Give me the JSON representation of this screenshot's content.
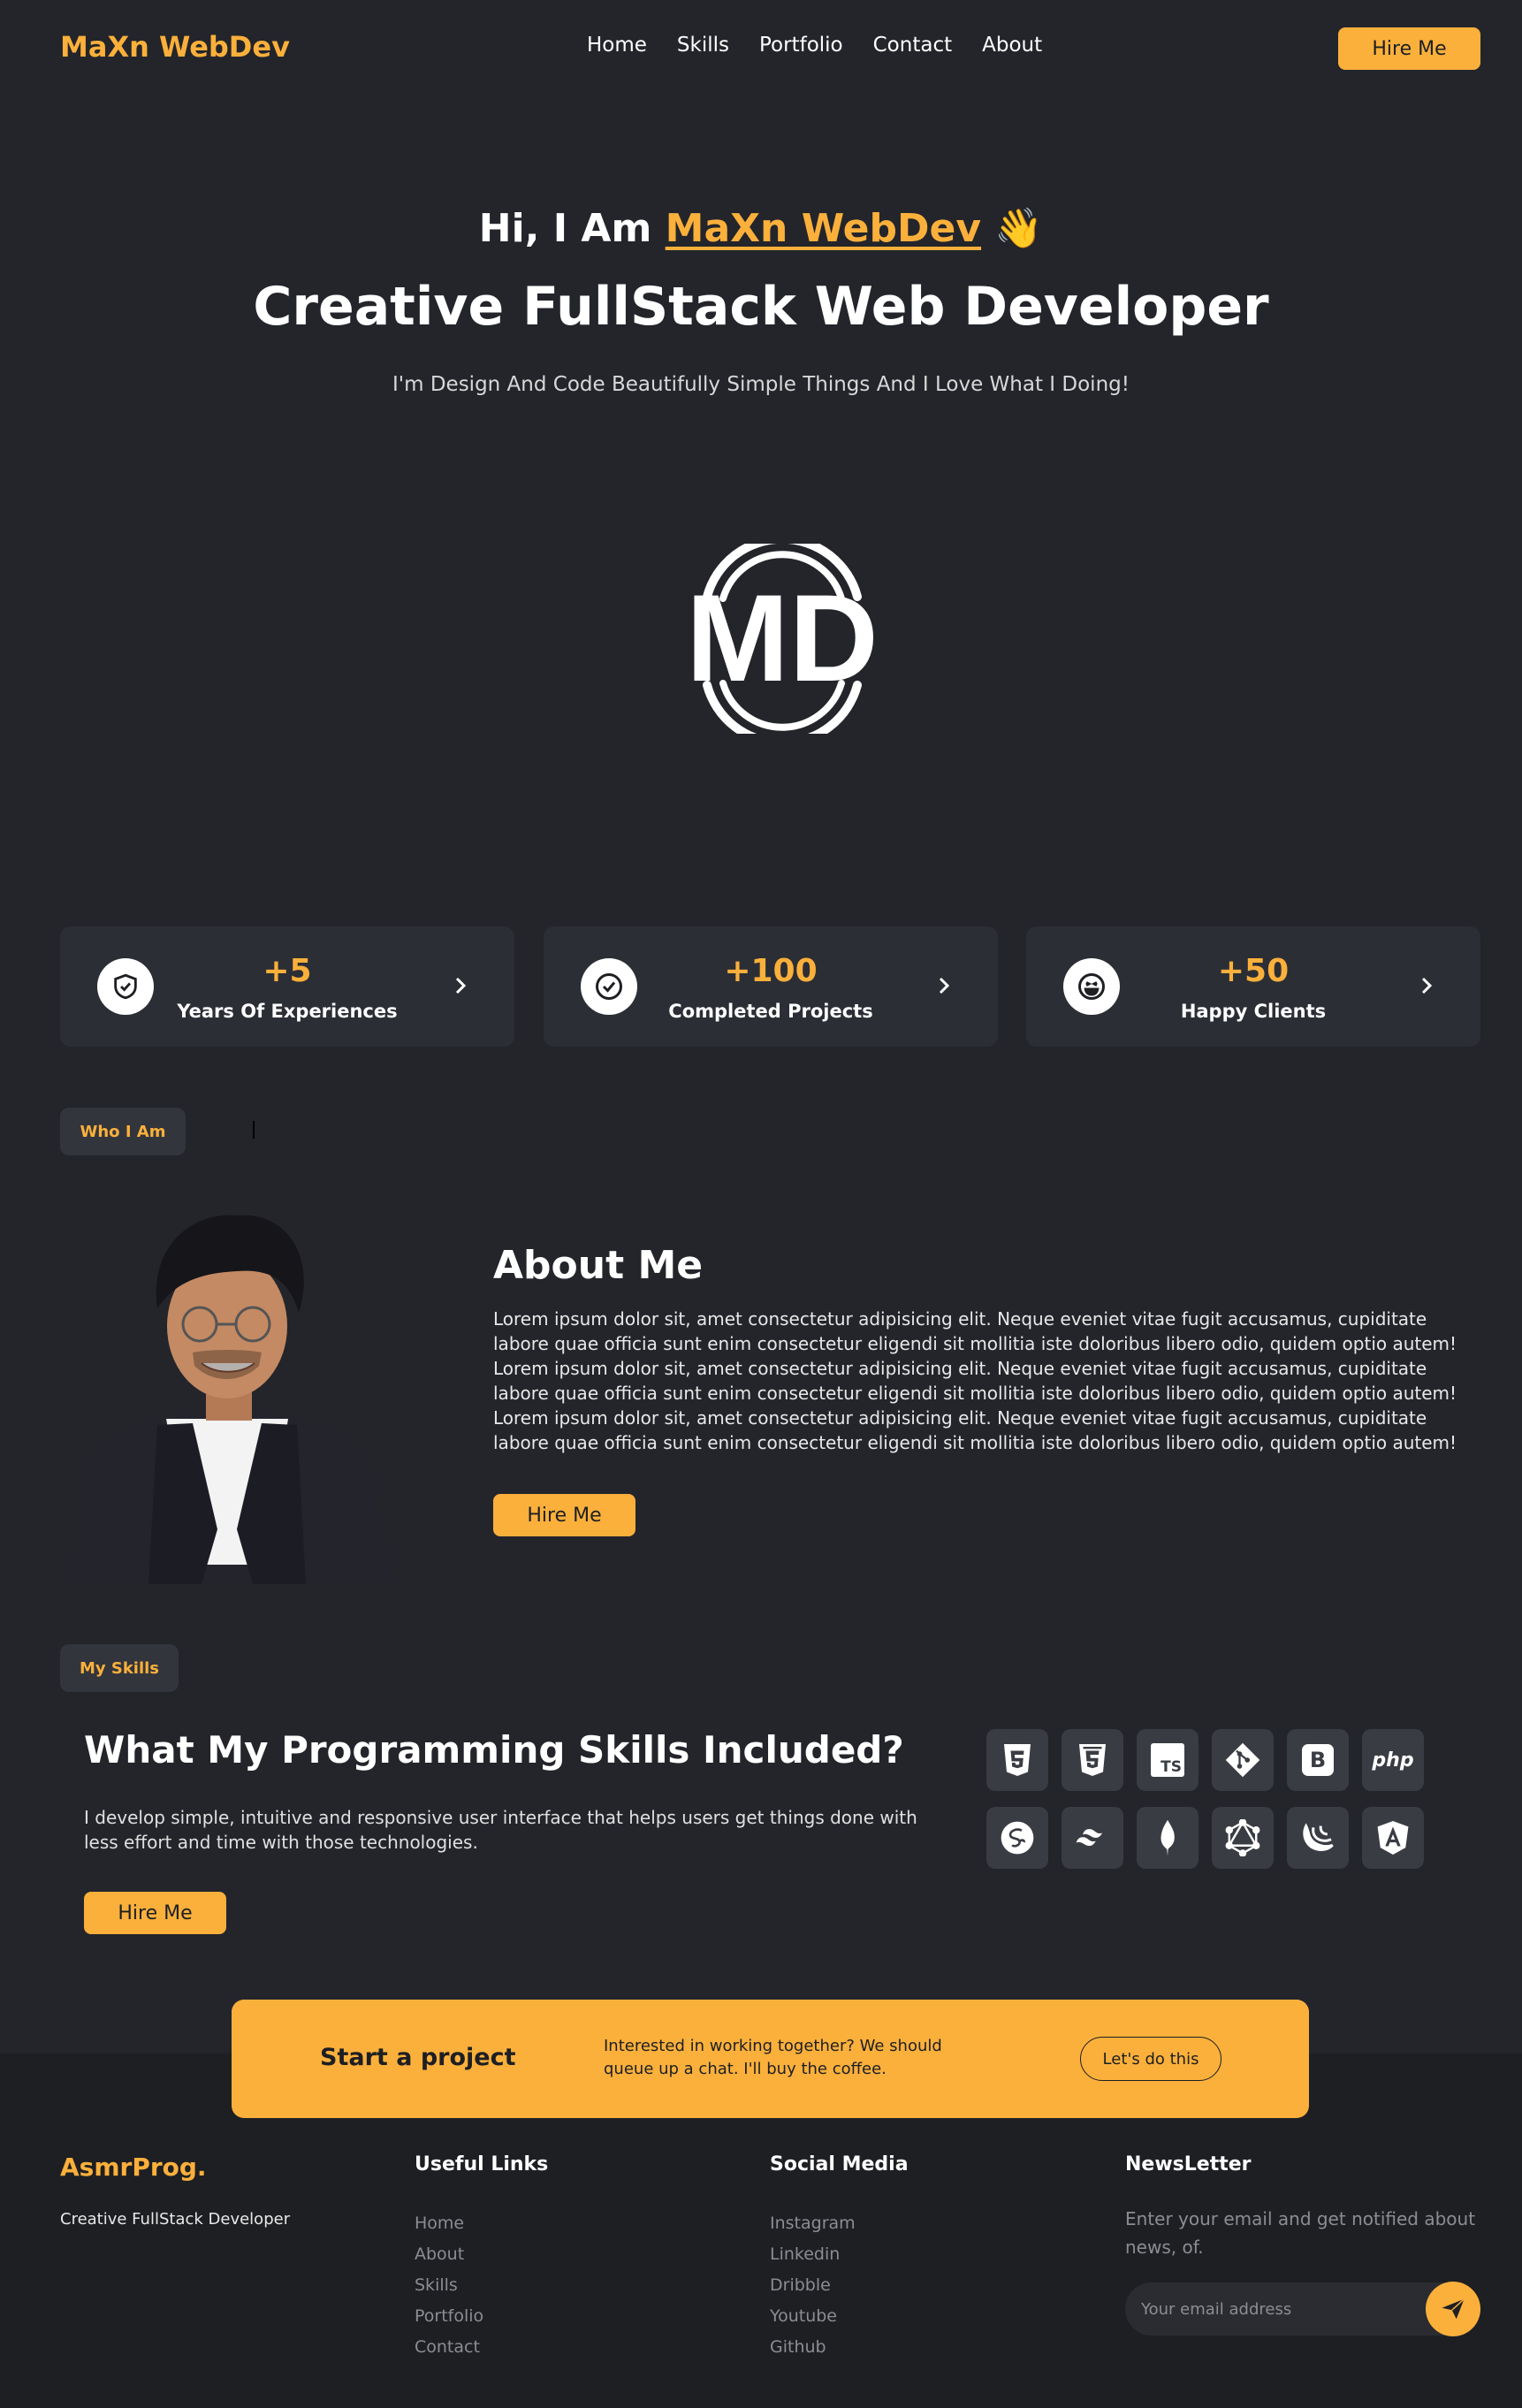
{
  "header": {
    "brand": "MaXn WebDev",
    "nav": [
      "Home",
      "Skills",
      "Portfolio",
      "Contact",
      "About"
    ],
    "hire_label": "Hire Me"
  },
  "hero": {
    "greeting": "Hi, I Am",
    "name": "MaXn WebDev",
    "wave": "👋",
    "title": "Creative FullStack Web Developer",
    "subtitle": "I'm Design And Code Beautifully Simple Things And I Love What I Doing!",
    "logo_text": "MD"
  },
  "stats": [
    {
      "value": "+5",
      "label": "Years Of Experiences",
      "icon": "shield-check-icon"
    },
    {
      "value": "+100",
      "label": "Completed Projects",
      "icon": "check-circle-icon"
    },
    {
      "value": "+50",
      "label": "Happy Clients",
      "icon": "laughing-face-icon"
    }
  ],
  "about": {
    "pill": "Who I Am",
    "title": "About Me",
    "text": "Lorem ipsum dolor sit, amet consectetur adipisicing elit. Neque eveniet vitae fugit accusamus, cupiditate labore quae officia sunt enim consectetur eligendi sit mollitia iste doloribus libero odio, quidem optio autem! Lorem ipsum dolor sit, amet consectetur adipisicing elit. Neque eveniet vitae fugit accusamus, cupiditate labore quae officia sunt enim consectetur eligendi sit mollitia iste doloribus libero odio, quidem optio autem! Lorem ipsum dolor sit, amet consectetur adipisicing elit. Neque eveniet vitae fugit accusamus, cupiditate labore quae officia sunt enim consectetur eligendi sit mollitia iste doloribus libero odio, quidem optio autem!",
    "hire_label": "Hire Me"
  },
  "skills": {
    "pill": "My Skills",
    "title": "What My Programming Skills Included?",
    "text": "I develop simple, intuitive and responsive user interface that helps users get things done with less effort and time with those technologies.",
    "hire_label": "Hire Me",
    "icons": [
      "html5-icon",
      "css3-icon",
      "typescript-icon",
      "git-icon",
      "bootstrap-icon",
      "php-icon",
      "sass-icon",
      "tailwind-icon",
      "mongodb-icon",
      "graphql-icon",
      "jquery-icon",
      "angular-icon"
    ],
    "icon_texts": {
      "ts": "TS",
      "b": "B",
      "php": "php",
      "a": "A"
    }
  },
  "cta": {
    "title": "Start a project",
    "text": "Interested in working together? We should queue up a chat. I'll buy the coffee.",
    "button": "Let's do this"
  },
  "footer": {
    "brand": "AsmrProg.",
    "tagline": "Creative FullStack Developer",
    "useful_links": {
      "title": "Useful Links",
      "items": [
        "Home",
        "About",
        "Skills",
        "Portfolio",
        "Contact"
      ]
    },
    "social_media": {
      "title": "Social Media",
      "items": [
        "Instagram",
        "Linkedin",
        "Dribble",
        "Youtube",
        "Github"
      ]
    },
    "newsletter": {
      "title": "NewsLetter",
      "text": "Enter your email and get notified about news, of.",
      "placeholder": "Your email address"
    }
  },
  "colors": {
    "accent": "#fbb03b",
    "background": "#23252b",
    "card": "#2c2e35",
    "footer": "#1e1f23"
  }
}
